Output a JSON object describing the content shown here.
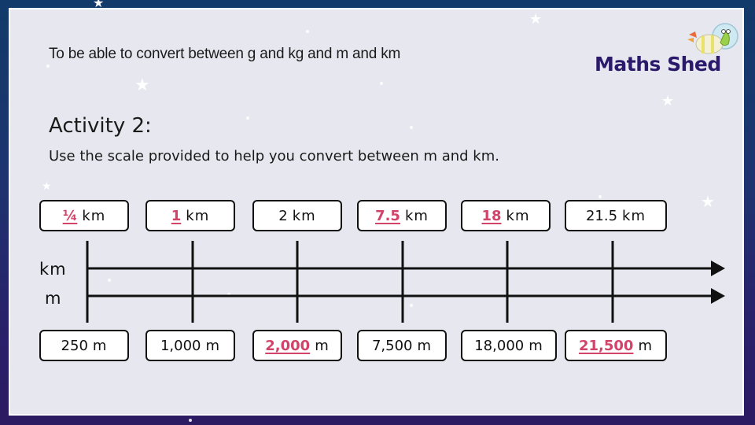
{
  "header": {
    "objective": "To be able to convert between g and kg and m and km",
    "logo_text": "Maths Shed",
    "logo_icon": "rocket-mascot-icon"
  },
  "activity": {
    "title": "Activity 2:",
    "instruction": "Use the scale provided to help you convert between m and km."
  },
  "scale": {
    "top_axis_label": "km",
    "bottom_axis_label": "m",
    "answer_color": "#d2436a",
    "km_boxes": [
      {
        "value": "¼",
        "unit": "km",
        "is_answer": true
      },
      {
        "value": "1",
        "unit": "km",
        "is_answer": true
      },
      {
        "value": "2",
        "unit": "km",
        "is_answer": false
      },
      {
        "value": "7.5",
        "unit": "km",
        "is_answer": true
      },
      {
        "value": "18",
        "unit": "km",
        "is_answer": true
      },
      {
        "value": "21.5",
        "unit": "km",
        "is_answer": false
      }
    ],
    "m_boxes": [
      {
        "value": "250",
        "unit": "m",
        "is_answer": false
      },
      {
        "value": "1,000",
        "unit": "m",
        "is_answer": false
      },
      {
        "value": "2,000",
        "unit": "m",
        "is_answer": true
      },
      {
        "value": "7,500",
        "unit": "m",
        "is_answer": false
      },
      {
        "value": "18,000",
        "unit": "m",
        "is_answer": false
      },
      {
        "value": "21,500",
        "unit": "m",
        "is_answer": true
      }
    ]
  }
}
